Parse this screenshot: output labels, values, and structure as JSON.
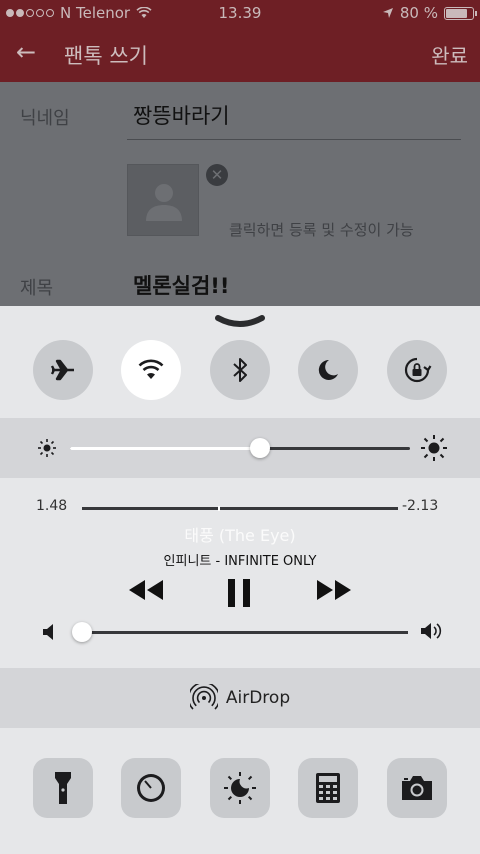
{
  "status": {
    "carrier": "N Telenor",
    "time": "13.39",
    "battery": "80 %",
    "battery_level": 0.8,
    "signal_bars_filled": 2,
    "signal_bars_total": 5
  },
  "header": {
    "title": "팬톡 쓰기",
    "done_label": "완료"
  },
  "form": {
    "nickname_label": "닉네임",
    "nickname_value": "짱뜽바라기",
    "photo_hint": "클릭하면 등록 및 수정이 가능",
    "subject_label": "제목",
    "subject_value": "멜론실검!!"
  },
  "control_center": {
    "toggles": [
      {
        "name": "airplane-mode",
        "icon": "airplane-icon",
        "active": false
      },
      {
        "name": "wifi",
        "icon": "wifi-icon",
        "active": true
      },
      {
        "name": "bluetooth",
        "icon": "bluetooth-icon",
        "active": false
      },
      {
        "name": "do-not-disturb",
        "icon": "moon-icon",
        "active": false
      },
      {
        "name": "rotation-lock",
        "icon": "rotation-lock-icon",
        "active": false
      }
    ],
    "brightness_level": 0.56,
    "music": {
      "elapsed": "1.48",
      "remaining": "-2.13",
      "progress": 0.43,
      "song_title": "태풍 (The Eye)",
      "artist_album": "인피니트 - INFINITE ONLY"
    },
    "volume_level": 0.0,
    "airdrop_label": "AirDrop",
    "shortcuts": [
      "flashlight-icon",
      "timer-icon",
      "night-shift-icon",
      "calculator-icon",
      "camera-icon"
    ]
  }
}
